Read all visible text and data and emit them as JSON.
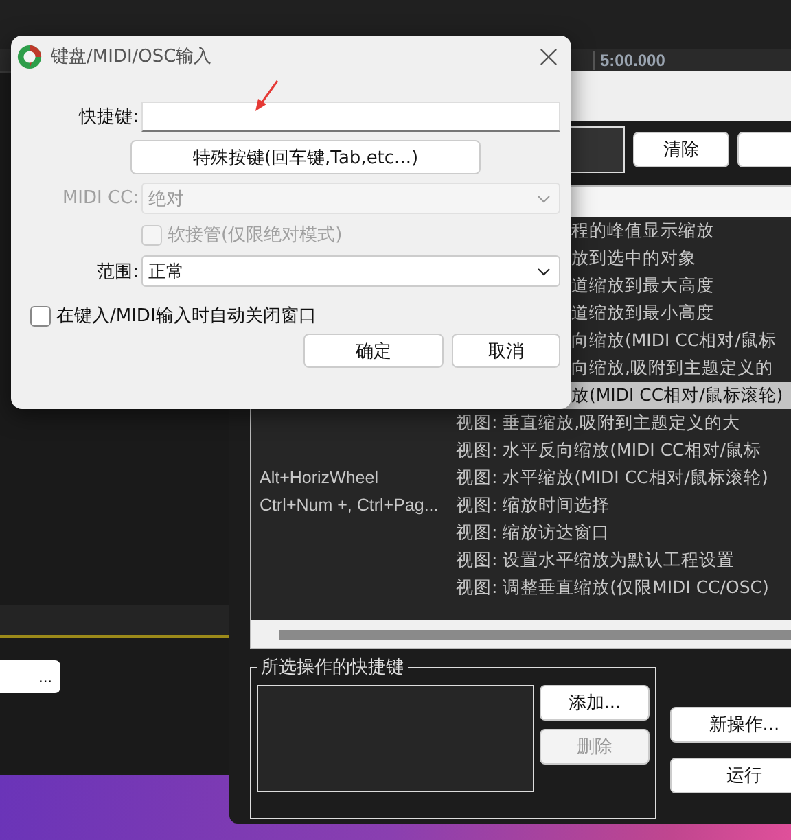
{
  "timeline": {
    "time": "5:00.000"
  },
  "daw": {
    "button": "..."
  },
  "actions": {
    "buttons": [
      {
        "label": "清除"
      }
    ],
    "rows": [
      {
        "kind": "covered",
        "shortcut": "",
        "description": "程的峰值显示缩放",
        "selected": false
      },
      {
        "kind": "covered",
        "shortcut": "",
        "description": "放到选中的对象",
        "selected": false
      },
      {
        "kind": "covered",
        "shortcut": "",
        "description": "道缩放到最大高度",
        "selected": false
      },
      {
        "kind": "covered",
        "shortcut": "",
        "description": "道缩放到最小高度",
        "selected": false
      },
      {
        "kind": "covered",
        "shortcut": "",
        "description": "向缩放(MIDI CC相对/鼠标",
        "selected": false
      },
      {
        "kind": "covered",
        "shortcut": "",
        "description": "向缩放,吸附到主题定义的",
        "selected": false
      },
      {
        "kind": "covered",
        "shortcut": "",
        "description": "放(MIDI CC相对/鼠标滚轮)",
        "selected": true
      },
      {
        "kind": "full",
        "shortcut": "",
        "description": "视图: 垂直缩放,吸附到主题定义的大",
        "selected": false
      },
      {
        "kind": "full",
        "shortcut": "",
        "description": "视图: 水平反向缩放(MIDI CC相对/鼠标",
        "selected": false
      },
      {
        "kind": "full",
        "shortcut": "Alt+HorizWheel",
        "description": "视图: 水平缩放(MIDI CC相对/鼠标滚轮)",
        "selected": false
      },
      {
        "kind": "full",
        "shortcut": "Ctrl+Num +, Ctrl+Pag...",
        "description": "视图: 缩放时间选择",
        "selected": false
      },
      {
        "kind": "full",
        "shortcut": "",
        "description": "视图: 缩放访达窗口",
        "selected": false
      },
      {
        "kind": "full",
        "shortcut": "",
        "description": "视图: 设置水平缩放为默认工程设置",
        "selected": false
      },
      {
        "kind": "full",
        "shortcut": "",
        "description": "视图: 调整垂直缩放(仅限MIDI CC/OSC)",
        "selected": false
      }
    ],
    "shortcuts_group": {
      "title": "所选操作的快捷键",
      "buttons": [
        {
          "label": "添加...",
          "disabled": false
        },
        {
          "label": "删除",
          "disabled": true
        }
      ]
    },
    "side_buttons": [
      {
        "label": "新操作..."
      },
      {
        "label": "运行"
      }
    ]
  },
  "dialog": {
    "title": "键盘/MIDI/OSC输入",
    "shortcut": {
      "label": "快捷键:"
    },
    "special_button": "特殊按键(回车键,Tab,etc...)",
    "midi_cc": {
      "label": "MIDI CC:",
      "value": "绝对",
      "disabled": true
    },
    "soft_takeover": {
      "label": "软接管(仅限绝对模式)",
      "checked": false,
      "disabled": true
    },
    "range": {
      "label": "范围:",
      "value": "正常"
    },
    "auto_close": {
      "label": "在键入/MIDI输入时自动关闭窗口",
      "checked": false
    },
    "buttons": [
      {
        "label": "确定"
      },
      {
        "label": "取消"
      }
    ]
  }
}
